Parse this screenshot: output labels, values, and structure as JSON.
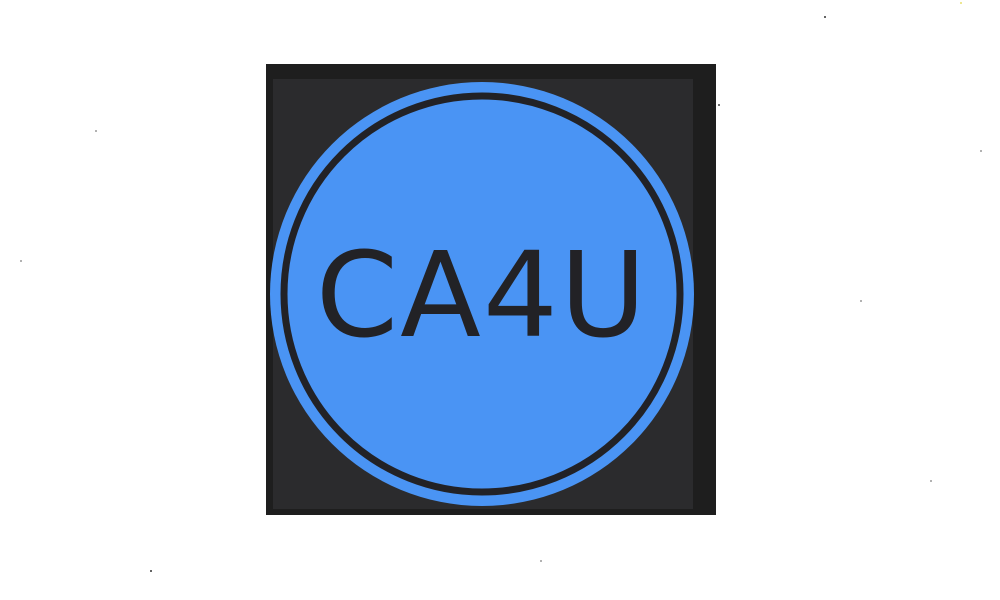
{
  "logo": {
    "text": "CA4U",
    "colors": {
      "frame": "#1e1e1e",
      "panel": "#2b2b2d",
      "circle_fill": "#4a94f4",
      "ring": "#222226",
      "text": "#222226",
      "page_background": "#ffffff"
    }
  }
}
